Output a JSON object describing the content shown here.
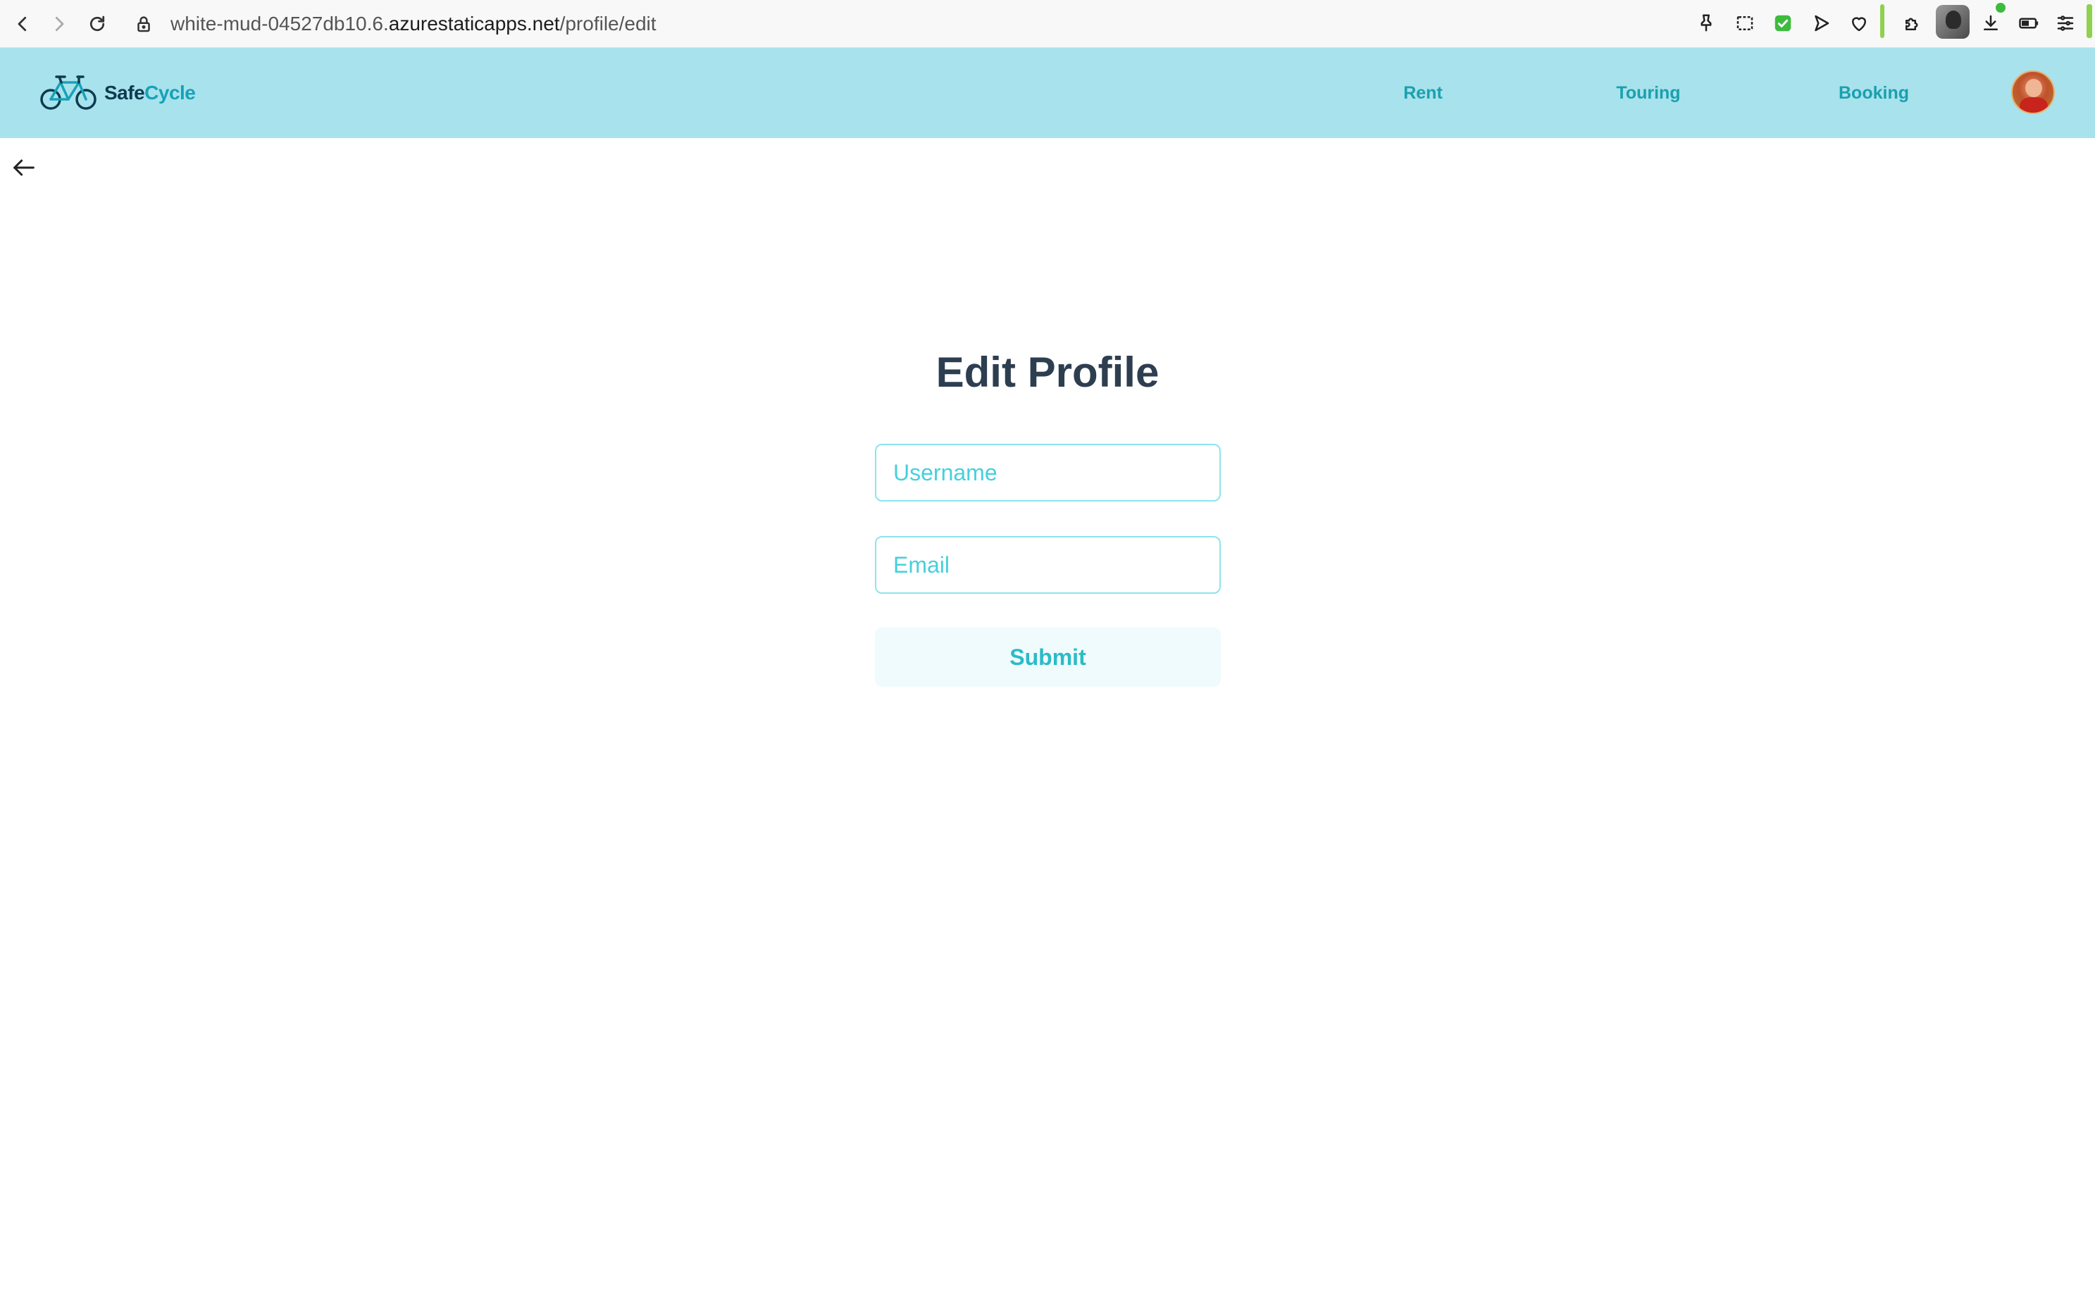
{
  "browser": {
    "url_prefix": "white-mud-04527db10.6.",
    "url_host": "azurestaticapps.net",
    "url_path": "/profile/edit"
  },
  "nav": {
    "brand_prefix": "Safe",
    "brand_suffix": "Cycle",
    "links": [
      "Rent",
      "Touring",
      "Booking"
    ],
    "accent_color": "#a8e2ec",
    "link_color": "#1aa0ad"
  },
  "form": {
    "title": "Edit Profile",
    "username_placeholder": "Username",
    "username_value": "",
    "email_placeholder": "Email",
    "email_value": "",
    "submit_label": "Submit"
  }
}
